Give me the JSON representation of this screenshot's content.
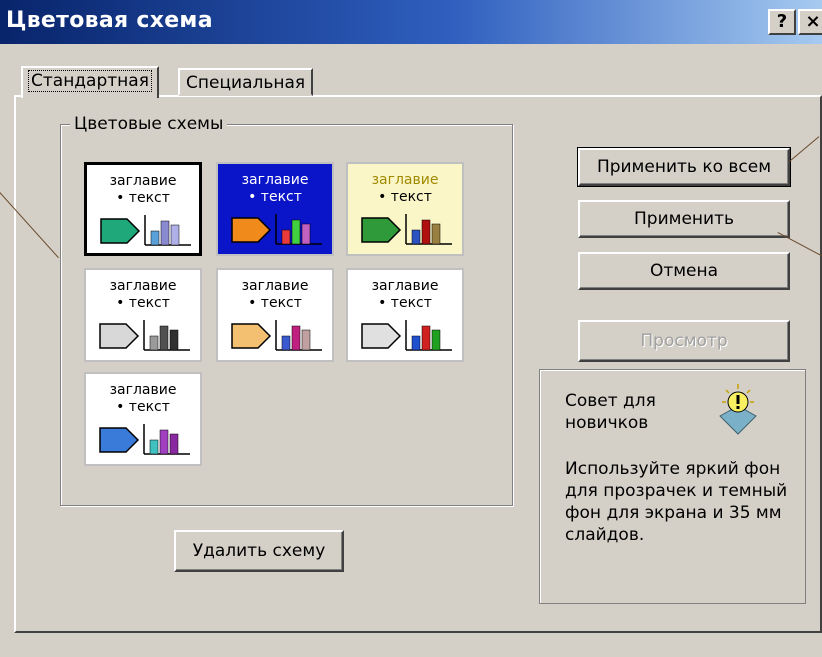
{
  "window": {
    "title": "Цветовая схема",
    "help": "?",
    "close": "×"
  },
  "tabs": [
    {
      "label": "Стандартная",
      "active": true
    },
    {
      "label": "Специальная",
      "active": false
    }
  ],
  "group": {
    "label": "Цветовые схемы"
  },
  "schemes": [
    {
      "title": "заглавие",
      "text": "• текст",
      "bg": "#ffffff",
      "fg": "#000000",
      "tc": "#000000",
      "arrow": "#1fa87a",
      "bars": [
        "#5aa0d8",
        "#8a8ad0",
        "#b0b0e8"
      ],
      "selected": true
    },
    {
      "title": "заглавие",
      "text": "• текст",
      "bg": "#0a14c8",
      "fg": "#ffffff",
      "tc": "#ffffff",
      "arrow": "#f08a1a",
      "bars": [
        "#e83a3a",
        "#40d040",
        "#c060c0"
      ],
      "selected": false
    },
    {
      "title": "заглавие",
      "text": "• текст",
      "bg": "#fbf6c8",
      "fg": "#000000",
      "tc": "#a08a00",
      "arrow": "#2e9a3a",
      "bars": [
        "#2a52c0",
        "#b01010",
        "#9a8040"
      ],
      "selected": false
    },
    {
      "title": "заглавие",
      "text": "• текст",
      "bg": "#ffffff",
      "fg": "#000000",
      "tc": "#000000",
      "arrow": "#d8d8d8",
      "bars": [
        "#9a9a9a",
        "#505050",
        "#303030"
      ],
      "selected": false
    },
    {
      "title": "заглавие",
      "text": "• текст",
      "bg": "#ffffff",
      "fg": "#000000",
      "tc": "#000000",
      "arrow": "#f2c070",
      "bars": [
        "#3a5ad0",
        "#c02080",
        "#c0a0a0"
      ],
      "selected": false
    },
    {
      "title": "заглавие",
      "text": "• текст",
      "bg": "#ffffff",
      "fg": "#000000",
      "tc": "#000000",
      "arrow": "#e0e0e0",
      "bars": [
        "#2050d0",
        "#d02020",
        "#20a020"
      ],
      "selected": false
    },
    {
      "title": "заглавие",
      "text": "• текст",
      "bg": "#ffffff",
      "fg": "#000000",
      "tc": "#000000",
      "arrow": "#3a7ad8",
      "bars": [
        "#40c0c0",
        "#a040c0",
        "#8a2aa0"
      ],
      "selected": false
    }
  ],
  "buttons": {
    "apply_all": "Применить ко всем",
    "apply": "Применить",
    "cancel": "Отмена",
    "preview": "Просмотр",
    "delete": "Удалить схему"
  },
  "tip": {
    "heading": "Совет для новичков",
    "body": "Используйте яркий фон для прозрачек и темный фон для экрана и 35 мм слайдов."
  },
  "icons": {
    "tip": "lightbulb-icon"
  }
}
